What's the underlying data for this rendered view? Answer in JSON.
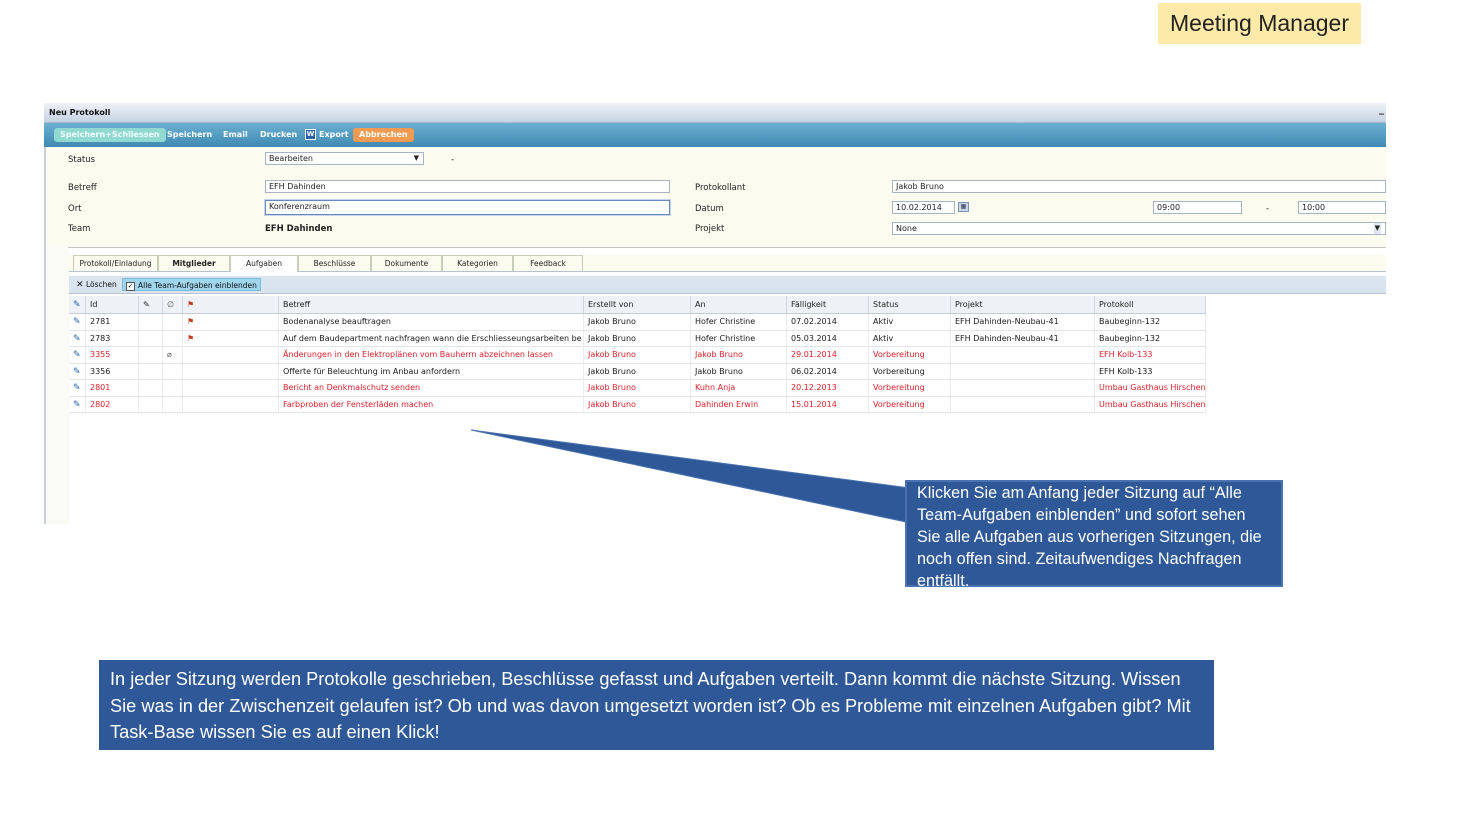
{
  "badge": "Meeting Manager",
  "window": {
    "title": "Neu Protokoll",
    "minimize": "_"
  },
  "toolbar": {
    "save_close": "Speichern+Schliessen",
    "save": "Speichern",
    "email": "Email",
    "print": "Drucken",
    "export_icon": "W",
    "export": "Export",
    "cancel": "Abbrechen"
  },
  "form": {
    "status_label": "Status",
    "status_value": "Bearbeiten",
    "status_dash": "-",
    "betreff_label": "Betreff",
    "betreff_value": "EFH Dahinden",
    "ort_label": "Ort",
    "ort_value": "Konferenzraum",
    "team_label": "Team",
    "team_value": "EFH Dahinden",
    "protokollant_label": "Protokollant",
    "protokollant_value": "Jakob Bruno",
    "datum_label": "Datum",
    "datum_value": "10.02.2014",
    "time_from": "09:00",
    "time_dash": "-",
    "time_to": "10:00",
    "projekt_label": "Projekt",
    "projekt_value": "None"
  },
  "tabs": [
    "Protokoll/Einladung",
    "Mitglieder",
    "Aufgaben",
    "Beschlüsse",
    "Dokumente",
    "Kategorien",
    "Feedback"
  ],
  "subtoolbar": {
    "delete": "Löschen",
    "show_all": "Alle Team-Aufgaben einblenden",
    "show_all_checked": "✓"
  },
  "grid": {
    "columns": [
      "Id",
      "Betreff",
      "Erstellt von",
      "An",
      "Fälligkeit",
      "Status",
      "Projekt",
      "Protokoll"
    ],
    "rows": [
      {
        "id": "2781",
        "betreff": "Bodenanalyse beauftragen",
        "erstellt": "Jakob Bruno",
        "an": "Hofer Christine",
        "faellig": "07.02.2014",
        "status": "Aktiv",
        "projekt": "EFH Dahinden-Neubau-41",
        "protokoll": "Baubeginn-132",
        "flag": "⚑",
        "clip": "",
        "color": "#1a1a1a"
      },
      {
        "id": "2783",
        "betreff": "Auf dem Baudepartment nachfragen wann die Erschliesseungsarbeiten be",
        "erstellt": "Jakob Bruno",
        "an": "Hofer Christine",
        "faellig": "05.03.2014",
        "status": "Aktiv",
        "projekt": "EFH Dahinden-Neubau-41",
        "protokoll": "Baubeginn-132",
        "flag": "⚑",
        "clip": "",
        "color": "#1a1a1a"
      },
      {
        "id": "3355",
        "betreff": "Änderungen in den Elektroplänen vom Bauherrn abzeichnen lassen",
        "erstellt": "Jakob Bruno",
        "an": "Jakob Bruno",
        "faellig": "29.01.2014",
        "status": "Vorbereitung",
        "projekt": "",
        "protokoll": "EFH Kolb-133",
        "flag": "",
        "clip": "⌀",
        "color": "#e0222c"
      },
      {
        "id": "3356",
        "betreff": "Offerte für Beleuchtung im Anbau anfordern",
        "erstellt": "Jakob Bruno",
        "an": "Jakob Bruno",
        "faellig": "06.02.2014",
        "status": "Vorbereitung",
        "projekt": "",
        "protokoll": "EFH Kolb-133",
        "flag": "",
        "clip": "",
        "color": "#1a1a1a"
      },
      {
        "id": "2801",
        "betreff": "Bericht an Denkmalschutz senden",
        "erstellt": "Jakob Bruno",
        "an": "Kuhn Anja",
        "faellig": "20.12.2013",
        "status": "Vorbereitung",
        "projekt": "",
        "protokoll": "Umbau Gasthaus Hirschen",
        "flag": "",
        "clip": "",
        "color": "#e0222c"
      },
      {
        "id": "2802",
        "betreff": "Farbproben der Fensterläden machen",
        "erstellt": "Jakob Bruno",
        "an": "Dahinden Erwin",
        "faellig": "15.01.2014",
        "status": "Vorbereitung",
        "projekt": "",
        "protokoll": "Umbau Gasthaus Hirschen",
        "flag": "",
        "clip": "",
        "color": "#e0222c"
      }
    ]
  },
  "callout_small": "Klicken Sie am Anfang jeder Sitzung auf “Alle Team-Aufgaben einblenden” und sofort sehen Sie alle Aufgaben aus vorherigen Sitzungen, die noch offen sind. Zeitaufwendiges Nachfragen entfällt.",
  "callout_large": "In jeder Sitzung werden Protokolle geschrieben, Beschlüsse gefasst und Aufgaben verteilt. Dann kommt die nächste Sitzung. Wissen Sie was in der Zwischenzeit gelaufen ist? Ob und was davon umgesetzt worden ist? Ob es Probleme mit einzelnen Aufgaben gibt? Mit Task-Base wissen Sie es auf einen Klick!",
  "colors": {
    "toolbar": "#3f89b3",
    "callout": "#2e5897",
    "badge": "#fde9a8",
    "overdue_text": "#e0222c"
  },
  "icons": {
    "row_edit": "pencil-icon",
    "flag": "flag-icon",
    "attachment": "paperclip-icon",
    "calendar": "calendar-icon",
    "delete": "x-icon"
  }
}
